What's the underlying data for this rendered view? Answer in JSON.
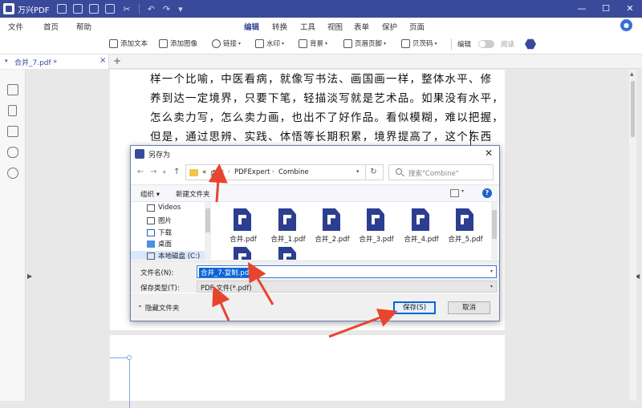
{
  "app": {
    "name": "万兴PDF",
    "window_buttons": [
      "—",
      "☐",
      "✕"
    ]
  },
  "menu": {
    "items": [
      "文件",
      "首页",
      "帮助",
      "编辑",
      "转换",
      "工具",
      "视图",
      "表单",
      "保护",
      "页面"
    ],
    "active": "编辑"
  },
  "toolbar": {
    "add_text": "添加文本",
    "add_image": "添加图像",
    "link": "链接",
    "watermark": "水印",
    "background": "背景",
    "header_footer": "页眉页脚",
    "bates": "贝茨码",
    "edit": "编辑",
    "read": "阅读"
  },
  "tab": {
    "name": "合并_7.pdf *",
    "close": "×",
    "plus": "+"
  },
  "document": {
    "lines": [
      "样一个比喻，中医看病，就像写书法、画国画一样，整体水平、修",
      "养到达一定境界，只要下笔，轻描淡写就是艺术品。如果没有水平，",
      "怎么卖力写，怎么卖力画，也出不了好作品。看似模糊，难以把握，",
      "但是，通过思辨、实践、体悟等长期积累，境界提高了，这个东西"
    ]
  },
  "dialog": {
    "title": "另存为",
    "close": "✕",
    "breadcrumb": [
      "«",
      "桌面",
      "PDFExpert",
      "Combine"
    ],
    "search_placeholder": "搜索\"Combine\"",
    "organize": "组织 ▾",
    "new_folder": "新建文件夹",
    "nav_items": [
      "Videos",
      "图片",
      "下载",
      "桌面",
      "本地磁盘 (C:)"
    ],
    "files": [
      "合并.pdf",
      "合并_1.pdf",
      "合并_2.pdf",
      "合并_3.pdf",
      "合并_4.pdf",
      "合并_5.pdf",
      "",
      ""
    ],
    "filename_label": "文件名(N):",
    "filename_value": "合并_7-复制.pdf",
    "filetype_label": "保存类型(T):",
    "filetype_value": "PDF 文件(*.pdf)",
    "hide_folders": "隐藏文件夹",
    "save_button": "保存(S)",
    "cancel_button": "取消"
  },
  "colors": {
    "brand": "#3a4a9a",
    "arrow": "#e8442e",
    "selection": "#0a64d8"
  }
}
